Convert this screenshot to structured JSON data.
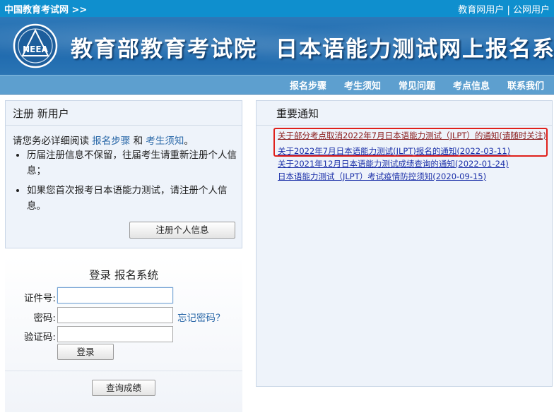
{
  "topbar": {
    "home_link": "中国教育考试网 >>",
    "user_links": [
      "教育网用户",
      "公网用户"
    ],
    "separator": "|"
  },
  "banner": {
    "logo_text": "NEEA",
    "title_part1": "教育部教育考试院",
    "title_part2": "日本语能力测试网上报名系统"
  },
  "nav": {
    "items": [
      "报名步骤",
      "考生须知",
      "常见问题",
      "考点信息",
      "联系我们"
    ]
  },
  "register": {
    "title": "注册 新用户",
    "intro_prefix": "请您务必详细阅读",
    "intro_link1": "报名步骤",
    "intro_and": "和",
    "intro_link2": "考生须知",
    "intro_suffix": "。",
    "bullets": [
      "历届注册信息不保留，往届考生请重新注册个人信息；",
      "如果您首次报考日本语能力测试，请注册个人信息。"
    ],
    "button": "注册个人信息"
  },
  "login": {
    "title": "登录 报名系统",
    "id_label": "证件号:",
    "password_label": "密码:",
    "captcha_label": "验证码:",
    "id_value": "",
    "password_value": "",
    "captcha_value": "",
    "forgot": "忘记密码？",
    "login_button": "登录",
    "score_button": "查询成绩"
  },
  "notice": {
    "title": "重要通知",
    "items": [
      "关于部分考点取消2022年7月日本语能力测试（JLPT）的通知(请随时关注)",
      "关于2022年7月日本语能力测试(JLPT)报名的通知(2022-03-11)",
      "关于2021年12月日本语能力测试成绩查询的通知(2022-01-24)",
      "日本语能力测试（JLPT）考试疫情防控须知(2020-09-15)"
    ]
  },
  "colors": {
    "topbar": "#0f8fce",
    "nav": "#5d9fcf",
    "link": "#1a2fa8",
    "highlight": "#e0201b"
  }
}
